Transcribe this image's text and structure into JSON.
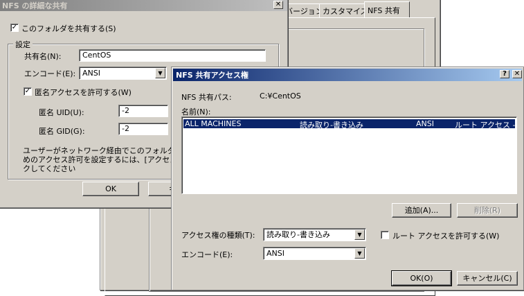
{
  "properties_window": {
    "tabs": [
      "バージョン",
      "カスタマイズ",
      "NFS 共有"
    ]
  },
  "detail_dialog": {
    "title": "NFS の詳細な共有",
    "close_glyph": "✕",
    "share_checkbox_label": "このフォルダを共有する(S)",
    "share_checked": true,
    "settings_group_label": "設定",
    "share_name_label": "共有名(N):",
    "share_name_value": "CentOS",
    "encode_label": "エンコード(E):",
    "encode_value": "ANSI",
    "anon_checkbox_label": "匿名アクセスを許可する(W)",
    "anon_checked": true,
    "anon_uid_label": "匿名 UID(U):",
    "anon_uid_value": "-2",
    "anon_gid_label": "匿名 GID(G):",
    "anon_gid_value": "-2",
    "info_line1": "ユーザーがネットワーク経由でこのフォルダにアク",
    "info_line2": "めのアクセス許可を設定するには、[アクセス許可",
    "info_line3": "クしてください",
    "ok_label": "OK",
    "cancel_label": "キャ"
  },
  "access_dialog": {
    "title": "NFS 共有アクセス権",
    "help_glyph": "?",
    "close_glyph": "✕",
    "path_label": "NFS 共有パス:",
    "path_value": "C:¥CentOS",
    "name_label": "名前(N):",
    "entries": [
      {
        "name": "ALL MACHINES",
        "access": "読み取り-書き込み",
        "encode": "ANSI",
        "root": "ルート アクセス - 許"
      }
    ],
    "add_label": "追加(A)...",
    "remove_label": "削除(R)",
    "access_type_label": "アクセス権の種類(T):",
    "access_type_value": "読み取り-書き込み",
    "root_checkbox_label": "ルート アクセスを許可する(W)",
    "root_checked": false,
    "encode_label": "エンコード(E):",
    "encode_value": "ANSI",
    "ok_label": "OK(O)",
    "cancel_label": "キャンセル(C)"
  },
  "colors": {
    "dialog_face": "#d4d0c8",
    "active_title": "#0a246a",
    "selection": "#0a246a"
  }
}
